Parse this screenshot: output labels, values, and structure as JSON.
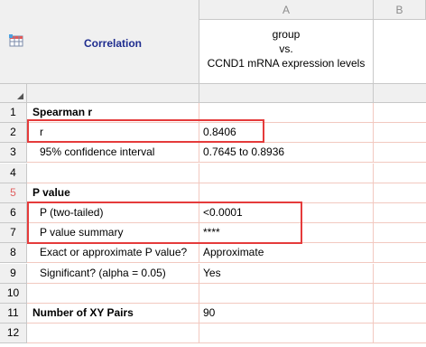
{
  "table": {
    "title": "Correlation",
    "icon": "table-grid-icon",
    "columns": [
      {
        "letter": "A",
        "title_lines": [
          "group",
          "vs.",
          "CCND1 mRNA expression levels"
        ]
      },
      {
        "letter": "B"
      }
    ],
    "rows": [
      {
        "num": "1",
        "label": "Spearman r",
        "value": "",
        "style": "bold"
      },
      {
        "num": "2",
        "label": "r",
        "value": "0.8406",
        "style": "indent"
      },
      {
        "num": "3",
        "label": "95% confidence interval",
        "value": "0.7645 to 0.8936",
        "style": "indent"
      },
      {
        "num": "4",
        "label": "",
        "value": "",
        "style": "indent"
      },
      {
        "num": "5",
        "label": "P value",
        "value": "",
        "style": "bold"
      },
      {
        "num": "6",
        "label": "P (two-tailed)",
        "value": "<0.0001",
        "style": "indent"
      },
      {
        "num": "7",
        "label": "P value summary",
        "value": "****",
        "style": "indent"
      },
      {
        "num": "8",
        "label": "Exact or approximate P value?",
        "value": "Approximate",
        "style": "indent"
      },
      {
        "num": "9",
        "label": "Significant? (alpha = 0.05)",
        "value": "Yes",
        "style": "indent"
      },
      {
        "num": "10",
        "label": "",
        "value": "",
        "style": "indent"
      },
      {
        "num": "11",
        "label": "Number of XY Pairs",
        "value": "90",
        "style": "bold"
      },
      {
        "num": "12",
        "label": "",
        "value": "",
        "style": "indent"
      }
    ]
  },
  "highlight_color": "#e53b3b"
}
